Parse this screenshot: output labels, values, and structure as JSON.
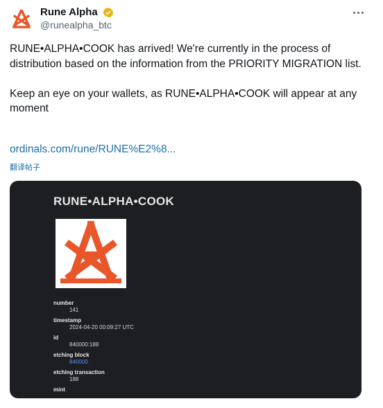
{
  "author": {
    "display_name": "Rune Alpha",
    "handle": "@runealpha_btc",
    "verified_color": "#e2b719",
    "avatar_icon": "rune-alpha-logo",
    "brand_color": "#e8562a"
  },
  "tweet": {
    "paragraph_1": "RUNE•ALPHA•COOK has arrived! We're currently in the process of distribution based on the information from the PRIORITY MIGRATION list.",
    "paragraph_2": "Keep an eye on your wallets, as RUNE•ALPHA•COOK will appear at any moment",
    "link": "ordinals.com/rune/RUNE%E2%8...",
    "translate_label": "翻译帖子"
  },
  "card": {
    "title": "RUNE•ALPHA•COOK",
    "image_icon": "rune-alpha-symbol",
    "fields": [
      {
        "label": "number",
        "value": "141"
      },
      {
        "label": "timestamp",
        "value": "2024-04-20 00:09:27 UTC"
      },
      {
        "label": "id",
        "value": "840000:188"
      },
      {
        "label": "etching block",
        "value": "840000"
      },
      {
        "label": "etching transaction",
        "value": "188"
      },
      {
        "label": "mint",
        "value": ""
      }
    ]
  }
}
